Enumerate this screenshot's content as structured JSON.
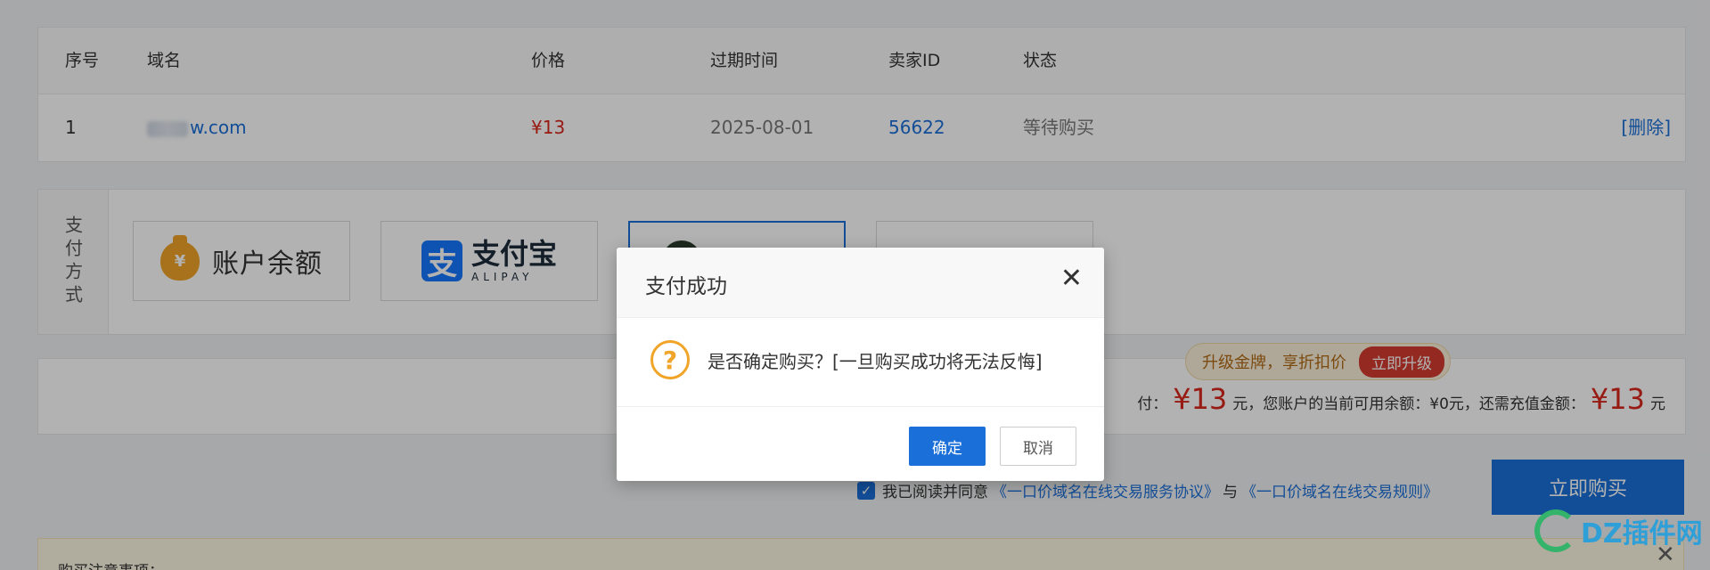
{
  "table": {
    "headers": [
      "序号",
      "域名",
      "价格",
      "过期时间",
      "卖家ID",
      "状态"
    ],
    "row": {
      "index": "1",
      "domain": "w.com",
      "price": "¥13",
      "expiry": "2025-08-01",
      "seller_id": "56622",
      "status": "等待购买",
      "delete": "[删除]"
    }
  },
  "payment": {
    "label": "支付方式",
    "balance": "账户余额",
    "balance_icon": "¥",
    "alipay_logo": "支",
    "alipay_cn": "支付宝",
    "alipay_en": "ALIPAY"
  },
  "upgrade": {
    "text": "升级金牌，享折扣价",
    "button": "立即升级"
  },
  "summary": {
    "prefix": "付：",
    "pay_amount": "¥13",
    "unit1": "元，您账户的当前可用余额：¥0元，还需充值金额：",
    "need_amount": "¥13",
    "unit2": "元"
  },
  "agreement": {
    "text": "我已阅读并同意",
    "link1": "《一口价域名在线交易服务协议》",
    "and": "与",
    "link2": "《一口价域名在线交易规则》"
  },
  "buy_button": "立即购买",
  "notice_title": "购买注意事项：",
  "modal": {
    "title": "支付成功",
    "close": "✕",
    "message": "是否确定购买？[一旦购买成功将无法反悔]",
    "ok": "确定",
    "cancel": "取消"
  },
  "watermark": {
    "text": "DZ插件网",
    "close": "✕"
  },
  "colors": {
    "accent": "#1b6fd8",
    "price_red": "#d9261c",
    "warning": "#f0a428"
  }
}
